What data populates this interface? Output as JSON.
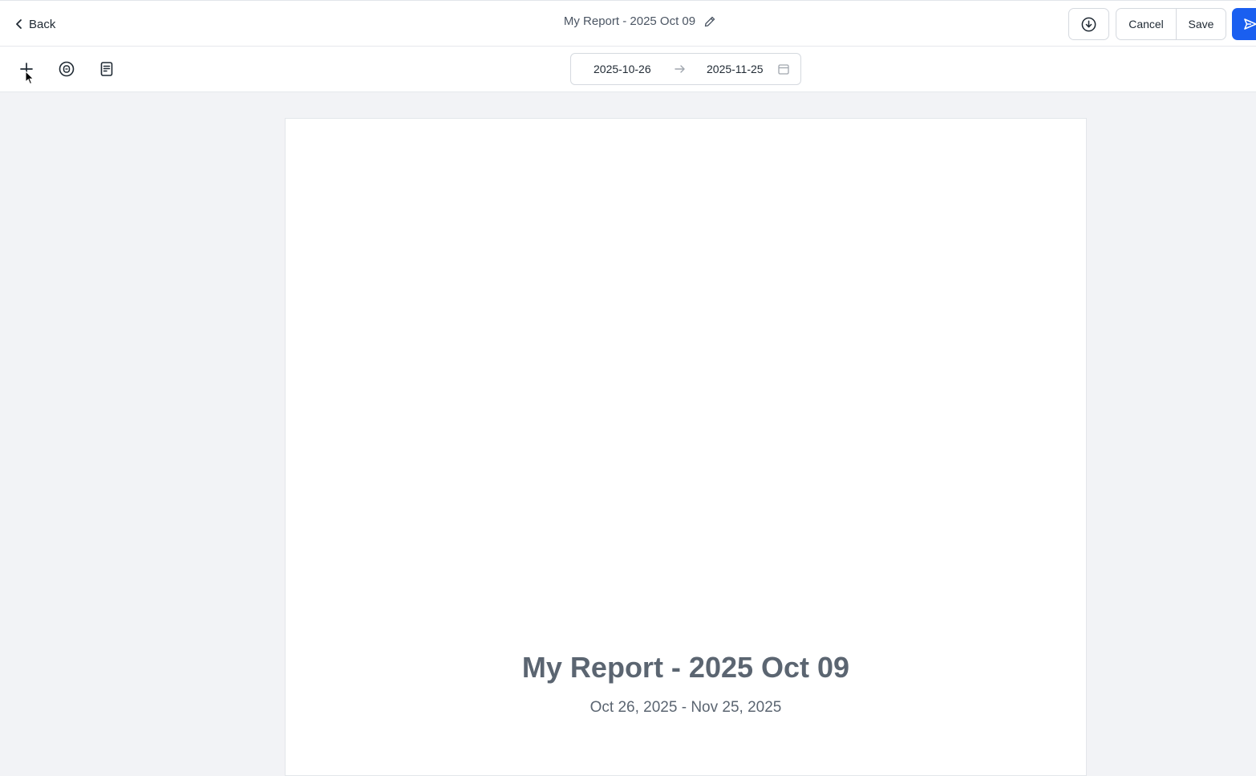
{
  "header": {
    "back_label": "Back",
    "title": "My Report - 2025 Oct 09",
    "cancel_label": "Cancel",
    "save_label": "Save",
    "send_color": "#1a5ff0"
  },
  "toolbar": {
    "icons": [
      "plus-icon",
      "variable-icon",
      "notes-icon"
    ],
    "date_start": "2025-10-26",
    "date_end": "2025-11-25"
  },
  "report": {
    "title": "My Report - 2025 Oct 09",
    "date_range": "Oct 26, 2025 - Nov 25, 2025"
  }
}
